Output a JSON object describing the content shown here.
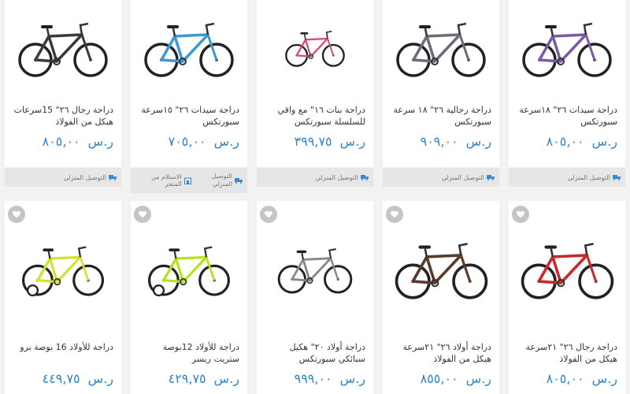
{
  "row1": [
    {
      "title": "دراجة سيدات ٢٦\" ١٨سرعة سبورتكس",
      "price": "٨٠٥,٠٠",
      "currency": "ر.س",
      "delivery": [
        "التوصيل المنزلي"
      ],
      "bike_color": "#7a5aa3"
    },
    {
      "title": "دراجة رجالية ٢٦\" ١٨ سرعة سبورتكس",
      "price": "٩٠٩,٠٠",
      "currency": "ر.س",
      "delivery": [
        "التوصيل المنزلي"
      ],
      "bike_color": "#6b6b7a"
    },
    {
      "title": "دراجة بنات ١٦\" مع واقي للسلسلة سبورتكس",
      "price": "٣٩٩,٧٥",
      "currency": "ر.س",
      "delivery": [
        "التوصيل المنزلي"
      ],
      "bike_color": "#d94a7a"
    },
    {
      "title": "دراجة سيدات ٢٦\" ١٥سرعة سبورتكس",
      "price": "٧٠٥,٠٠",
      "currency": "ر.س",
      "delivery": [
        "التوصيل المنزلي",
        "الاستلام من المتجر"
      ],
      "bike_color": "#3a9ad1"
    },
    {
      "title": "دراجة رجال ٢٦\" 15سرعات هيكل من الفولاذ",
      "price": "٨٠٥,٠٠",
      "currency": "ر.س",
      "delivery": [
        "التوصيل المنزلي"
      ],
      "bike_color": "#3a3a3a"
    }
  ],
  "row2": [
    {
      "title": "دراجة رجال ٢٦\" ٢١سرعة هيكل من الفولاذ",
      "price": "٨٠٥,٠٠",
      "currency": "ر.س",
      "bike_color": "#c8282e"
    },
    {
      "title": "دراجة أولاد ٢٦\" ٢١سرعة هيكل من الفولاذ",
      "price": "٨٥٥,٠٠",
      "currency": "ر.س",
      "bike_color": "#5a3a2a"
    },
    {
      "title": "دراجة أولاد ٢٠\" هكيل سبائكي سبورتكس",
      "price": "٩٩٩,٠٠",
      "currency": "ر.س",
      "bike_color": "#8a8a8a"
    },
    {
      "title": "دراجة للأولاد 12بوصة ستريت ريسر",
      "price": "٤٢٩,٧٥",
      "currency": "ر.س",
      "bike_color": "#b4e21b"
    },
    {
      "title": "دراجة للأولاد 16 بوصة برو",
      "price": "٤٤٩,٧٥",
      "currency": "ر.س",
      "bike_color": "#d4e02a"
    }
  ],
  "icons": {
    "wishlist": "heart-icon",
    "delivery": "truck-icon",
    "pickup": "store-icon",
    "product": "bicycle-image"
  }
}
